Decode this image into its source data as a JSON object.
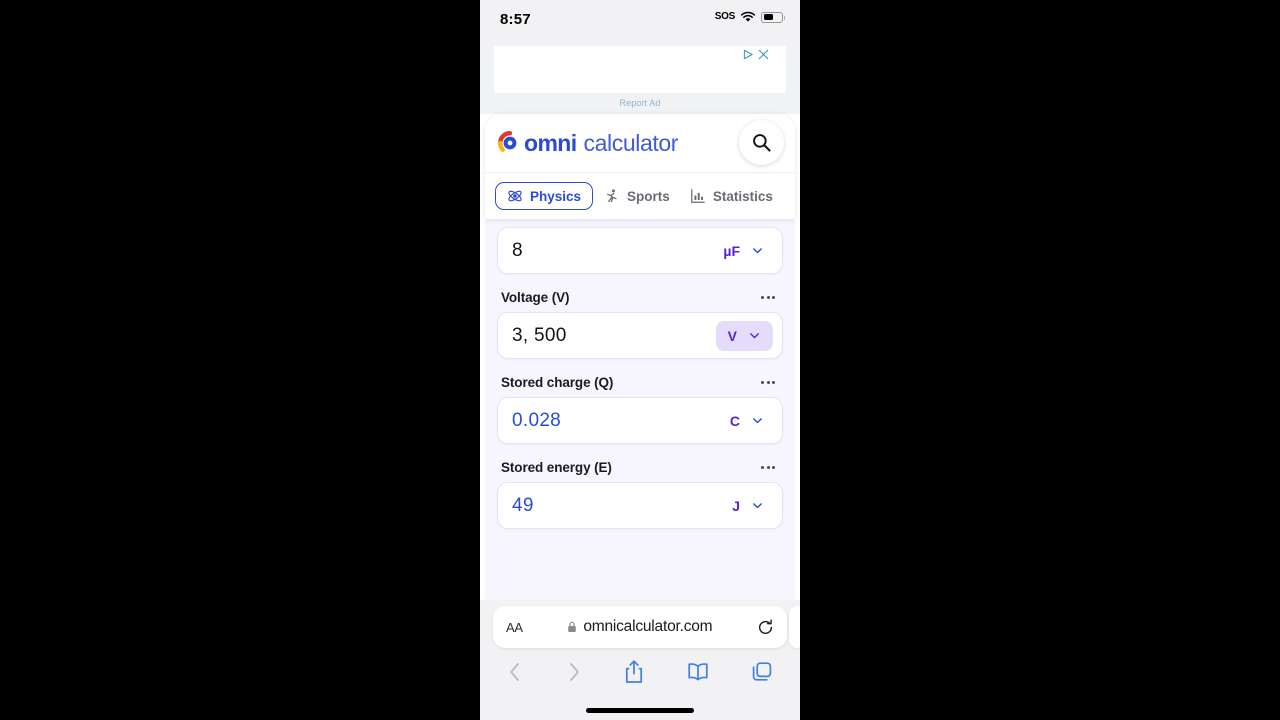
{
  "statusbar": {
    "time": "8:57",
    "sos_label": "SOS",
    "wifi_icon": "wifi-icon",
    "battery_icon": "battery-icon"
  },
  "ad": {
    "report_label": "Report Ad",
    "adchoices_icon": "adchoices-icon",
    "close_icon": "close-icon"
  },
  "site": {
    "brand_primary": "omni",
    "brand_secondary": "calculator",
    "search_icon": "search-icon",
    "categories": [
      {
        "label": "Physics",
        "icon": "atom-icon",
        "active": true
      },
      {
        "label": "Sports",
        "icon": "runner-icon",
        "active": false
      },
      {
        "label": "Statistics",
        "icon": "bar-chart-icon",
        "active": false
      }
    ]
  },
  "calculator": {
    "fields": [
      {
        "label": "",
        "value": "8",
        "unit": "µF",
        "is_result": false,
        "unit_selected": false
      },
      {
        "label": "Voltage (V)",
        "value": "3, 500",
        "unit": "V",
        "is_result": false,
        "unit_selected": true
      },
      {
        "label": "Stored charge (Q)",
        "value": "0.028",
        "unit": "C",
        "is_result": true,
        "unit_selected": false
      },
      {
        "label": "Stored energy (E)",
        "value": "49",
        "unit": "J",
        "is_result": true,
        "unit_selected": false
      }
    ],
    "menu_icon": "more-options-icon",
    "chevron_icon": "chevron-down-icon"
  },
  "safari": {
    "text_size_label": "AA",
    "lock_icon": "lock-icon",
    "url": "omnicalculator.com",
    "reload_icon": "reload-icon",
    "back_icon": "back-chevron-icon",
    "forward_icon": "forward-chevron-icon",
    "share_icon": "share-icon",
    "bookmarks_icon": "bookmarks-icon",
    "tabs_icon": "tabs-icon"
  },
  "colors": {
    "brand_blue": "#2a4bd7",
    "unit_purple": "#5b21d6",
    "unit_pill_bg": "#e3dcfa",
    "page_bg": "#f7f5fd",
    "safari_blue": "#3f7fe8"
  }
}
